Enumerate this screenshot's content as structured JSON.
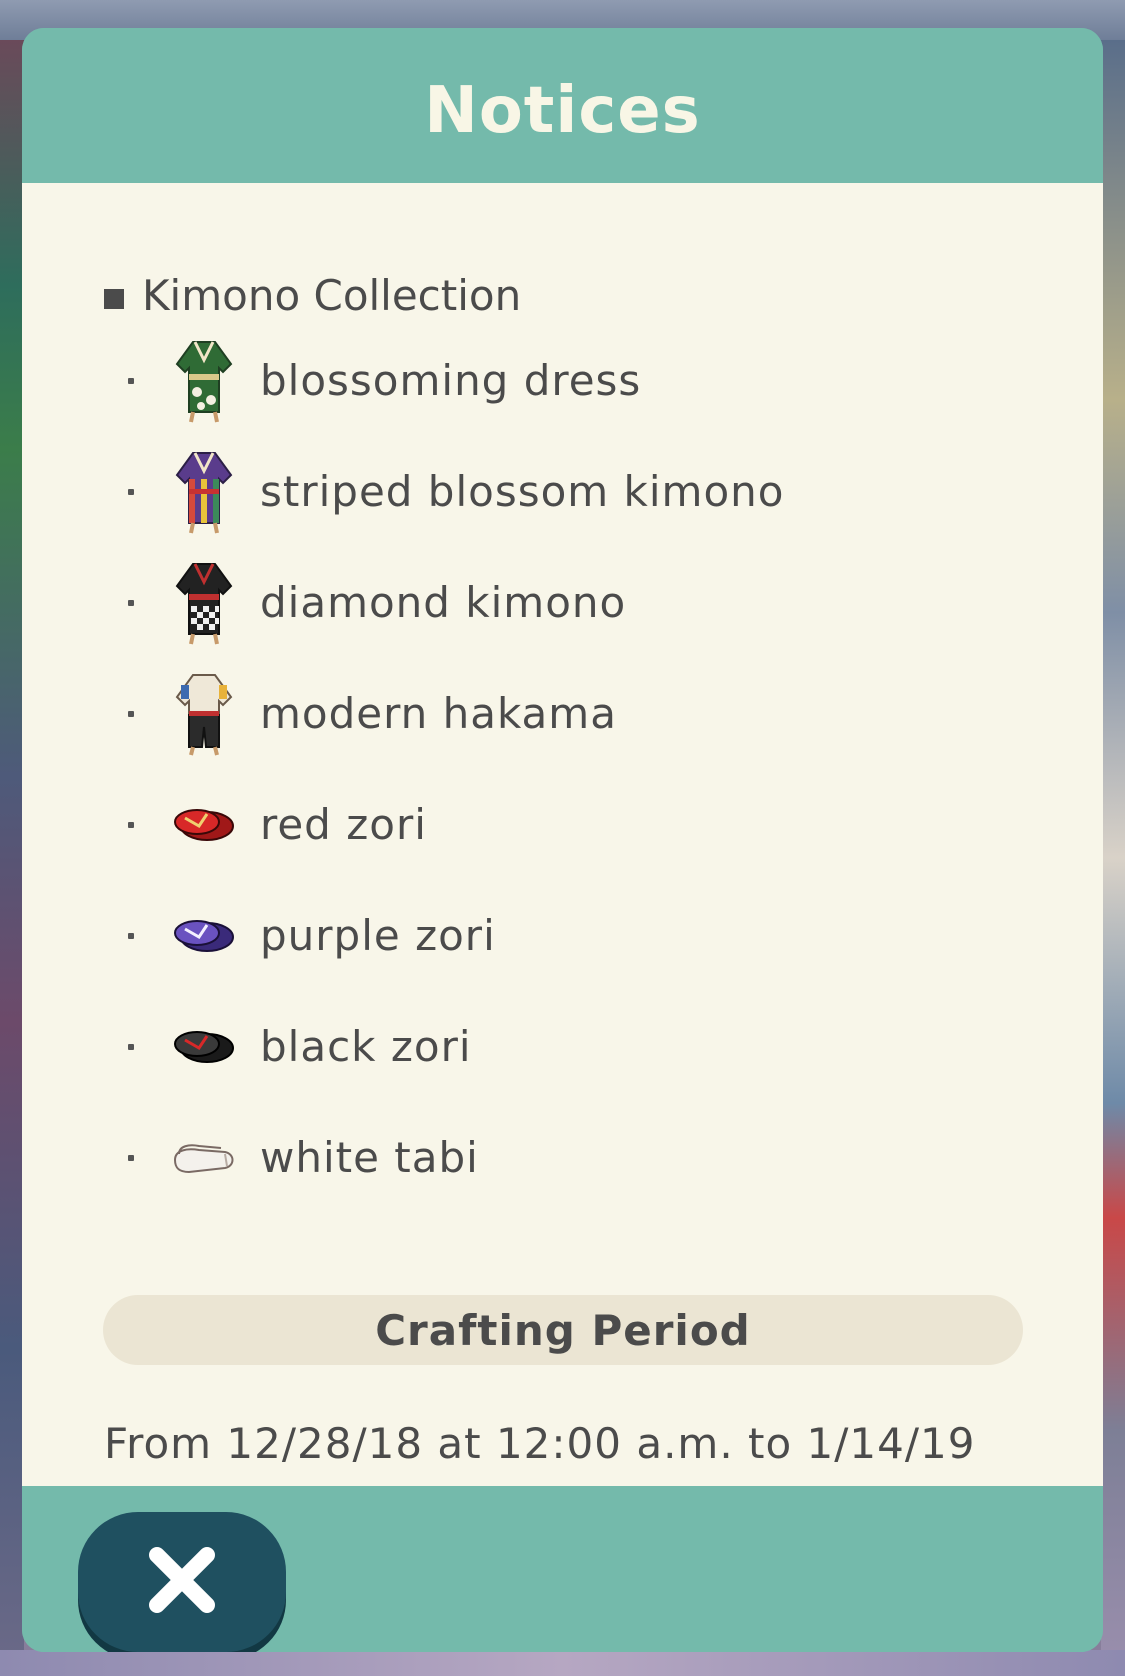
{
  "dialog": {
    "title": "Notices",
    "section_heading": "Kimono Collection",
    "items": [
      {
        "label": "blossoming dress",
        "icon": "green-kimono-icon"
      },
      {
        "label": "striped blossom kimono",
        "icon": "striped-kimono-icon"
      },
      {
        "label": "diamond kimono",
        "icon": "diamond-kimono-icon"
      },
      {
        "label": "modern hakama",
        "icon": "hakama-icon"
      },
      {
        "label": "red zori",
        "icon": "red-zori-icon"
      },
      {
        "label": "purple zori",
        "icon": "purple-zori-icon"
      },
      {
        "label": "black zori",
        "icon": "black-zori-icon"
      },
      {
        "label": "white tabi",
        "icon": "white-tabi-icon"
      }
    ],
    "crafting_period_label": "Crafting Period",
    "period_text": "From 12/28/18 at 12:00 a.m. to 1/14/19",
    "close_icon": "close-icon"
  },
  "colors": {
    "header": "#74baab",
    "content_background": "#f8f6e9",
    "text": "#4b4b4b",
    "close_button": "#1f5060",
    "pill": "#ebe5d3"
  }
}
